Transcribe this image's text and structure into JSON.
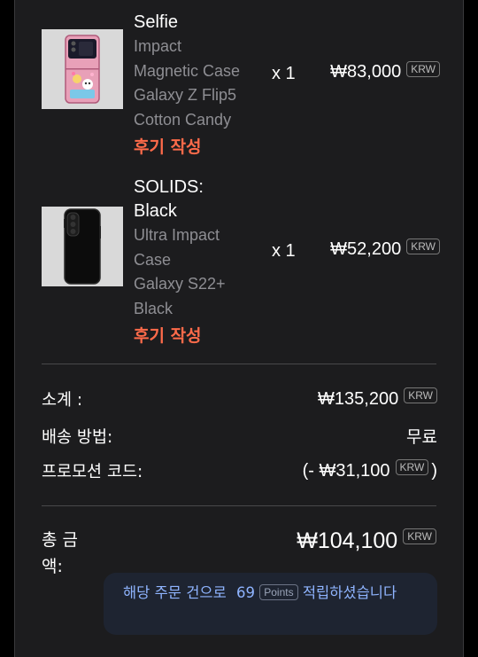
{
  "items": [
    {
      "name": "Selfie",
      "desc_lines": [
        "Impact",
        "Magnetic Case",
        "Galaxy Z Flip5",
        "Cotton Candy"
      ],
      "review_label": "후기 작성",
      "qty": "x 1",
      "price": "₩83,000",
      "currency": "KRW",
      "thumb_icon": "flip-phone-case-icon"
    },
    {
      "name_lines": [
        "SOLIDS:",
        "Black"
      ],
      "desc_lines": [
        "Ultra Impact",
        "Case",
        "Galaxy S22+",
        "Black"
      ],
      "review_label": "후기 작성",
      "qty": "x 1",
      "price": "₩52,200",
      "currency": "KRW",
      "thumb_icon": "black-phone-case-icon"
    }
  ],
  "summary": {
    "subtotal_label": "소계 :",
    "subtotal_value": "₩135,200",
    "subtotal_currency": "KRW",
    "shipping_label": "배송 방법:",
    "shipping_value": "무료",
    "promo_label": "프로모션 코드:",
    "promo_prefix": "(- ₩31,100",
    "promo_currency": "KRW",
    "promo_suffix": ")",
    "total_label": "총 금액:",
    "total_value": "₩104,100",
    "total_currency": "KRW"
  },
  "points": {
    "before": "해당 주문 건으로",
    "amount": "69",
    "badge": "Points",
    "after": "적립하셨습니다"
  },
  "colors": {
    "background": "#1c1c1e",
    "review": "#ff6b4a",
    "points_text": "#8fb4ff",
    "points_box": "#1e2431"
  }
}
